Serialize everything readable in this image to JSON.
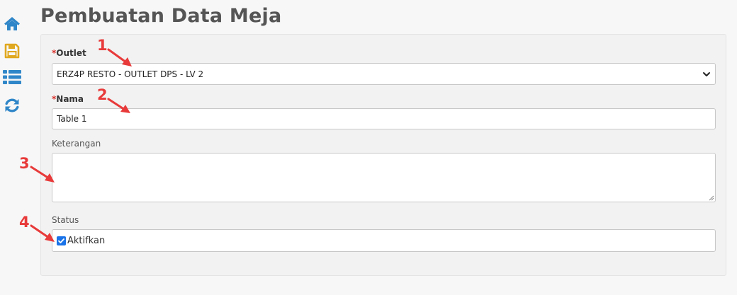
{
  "sidebar": {
    "icons": [
      "home-icon",
      "save-icon",
      "list-icon",
      "refresh-icon"
    ],
    "colors": {
      "home": "#2f86c8",
      "save": "#e0a81f",
      "list": "#2f86c8",
      "refresh": "#2f86c8"
    }
  },
  "page": {
    "title": "Pembuatan Data Meja"
  },
  "form": {
    "outlet": {
      "required_mark": "*",
      "label": "Outlet",
      "value": "ERZ4P RESTO - OUTLET DPS - LV 2"
    },
    "nama": {
      "required_mark": "*",
      "label": "Nama",
      "value": "Table 1"
    },
    "keterangan": {
      "label": "Keterangan",
      "value": ""
    },
    "status": {
      "label": "Status",
      "checkbox_label": "Aktifkan",
      "checked": true
    }
  },
  "annotations": [
    "1",
    "2",
    "3",
    "4"
  ],
  "colors": {
    "annotation": "#e83a3a",
    "required": "#d9302b",
    "checkbox": "#1a73e8"
  }
}
